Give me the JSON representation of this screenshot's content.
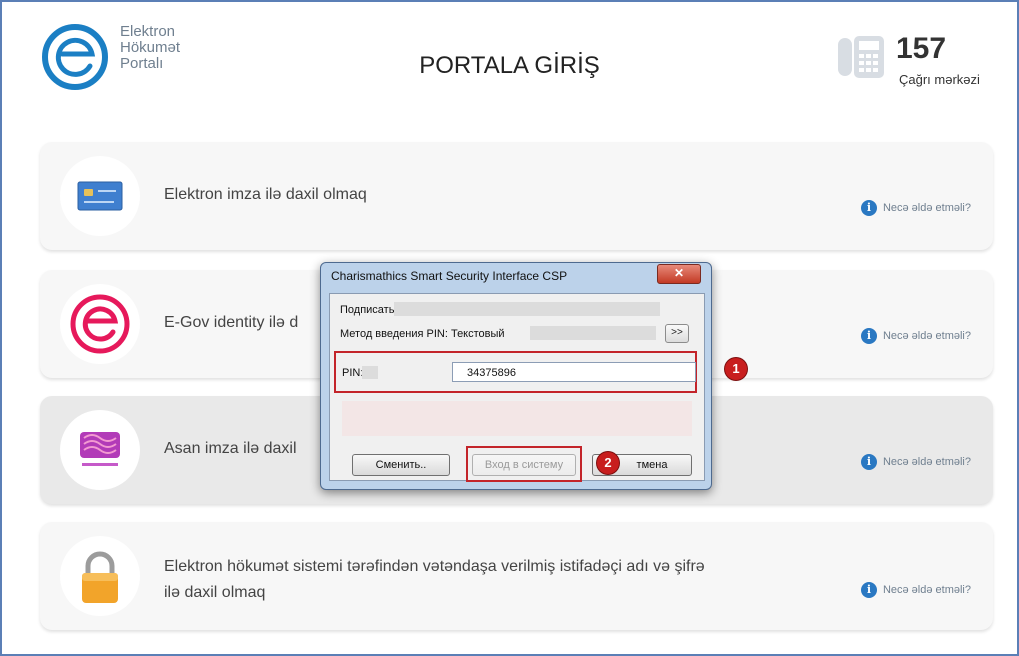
{
  "header": {
    "logo_lines": [
      "Elektron",
      "Hökumət",
      "Portalı"
    ],
    "title": "PORTALA GİRİŞ",
    "hotline_number": "157",
    "hotline_label": "Çağrı mərkəzi"
  },
  "login_options": [
    {
      "label": "Elektron imza ilə daxil olmaq",
      "help": "Necə əldə etməli?",
      "icon": "id-card-icon"
    },
    {
      "label": "E-Gov identity ilə d",
      "help": "Necə əldə etməli?",
      "icon": "egov-logo-icon"
    },
    {
      "label": "Asan imza ilə daxil",
      "help": "Necə əldə etməli?",
      "icon": "asan-imza-icon"
    },
    {
      "label_line1": "Elektron hökumət sistemi tərəfindən vətəndaşa verilmiş istifadəçi adı və şifrə",
      "label_line2": "ilə daxil olmaq",
      "help": "Necə əldə etməli?",
      "icon": "padlock-icon"
    }
  ],
  "dialog": {
    "title": "Charismathics Smart Security Interface CSP",
    "sign_label": "Подписать",
    "pin_method_label": "Метод введения PIN: Текстовый",
    "expand_label": ">>",
    "pin_label": "PIN:",
    "pin_value": "34375896",
    "change_button": "Сменить..",
    "login_button": "Вход в систему",
    "cancel_button": "тмена"
  },
  "annotations": {
    "step1": "1",
    "step2": "2"
  },
  "colors": {
    "brand_blue": "#1b7fc4",
    "egov_pink": "#e6195b",
    "annotation_red": "#c3242a",
    "info_blue": "#2a78c2"
  }
}
